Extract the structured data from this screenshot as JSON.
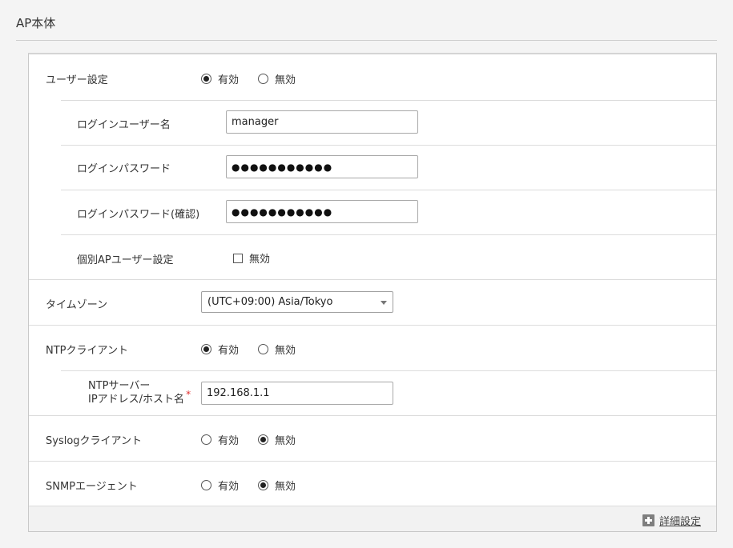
{
  "section": {
    "title": "AP本体"
  },
  "options": {
    "enabled": "有効",
    "disabled": "無効"
  },
  "user_settings": {
    "label": "ユーザー設定",
    "selected": "enabled",
    "login_user": {
      "label": "ログインユーザー名",
      "value": "manager"
    },
    "login_password": {
      "label": "ログインパスワード",
      "value": "●●●●●●●●●●●"
    },
    "login_password_confirm": {
      "label": "ログインパスワード(確認)",
      "value": "●●●●●●●●●●●"
    },
    "individual_ap_user": {
      "label": "個別APユーザー設定",
      "checkbox_label": "無効",
      "checked": false
    }
  },
  "timezone": {
    "label": "タイムゾーン",
    "value": "(UTC+09:00) Asia/Tokyo"
  },
  "ntp_client": {
    "label": "NTPクライアント",
    "selected": "enabled",
    "server": {
      "label_line1": "NTPサーバー",
      "label_line2": "IPアドレス/ホスト名",
      "required_mark": "*",
      "value": "192.168.1.1"
    }
  },
  "syslog_client": {
    "label": "Syslogクライアント",
    "selected": "disabled"
  },
  "snmp_agent": {
    "label": "SNMPエージェント",
    "selected": "disabled"
  },
  "footer": {
    "detail_label": "詳細設定"
  }
}
